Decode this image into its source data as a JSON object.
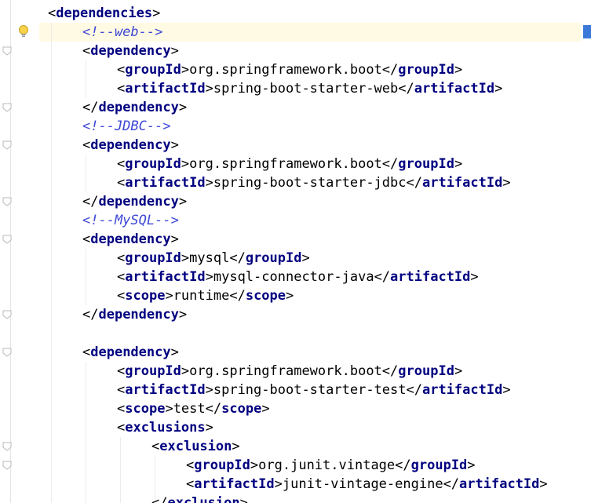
{
  "editor": {
    "language": "xml",
    "highlight_color": "#fffae3",
    "tag_color": "#000080",
    "comment_color": "#3d48d6",
    "gutter_icons": [
      "intention-bulb-icon",
      "fold-icon"
    ]
  },
  "code": {
    "lines": [
      {
        "indent": 1,
        "parts": [
          {
            "k": "p",
            "v": "<"
          },
          {
            "k": "t",
            "v": "dependencies"
          },
          {
            "k": "p",
            "v": ">"
          }
        ]
      },
      {
        "indent": 2,
        "parts": [
          {
            "k": "c",
            "v": "<!--web-->"
          }
        ]
      },
      {
        "indent": 2,
        "parts": [
          {
            "k": "p",
            "v": "<"
          },
          {
            "k": "t",
            "v": "dependency"
          },
          {
            "k": "p",
            "v": ">"
          }
        ]
      },
      {
        "indent": 3,
        "parts": [
          {
            "k": "p",
            "v": "<"
          },
          {
            "k": "t",
            "v": "groupId"
          },
          {
            "k": "p",
            "v": ">"
          },
          {
            "k": "tx",
            "v": "org.springframework.boot"
          },
          {
            "k": "p",
            "v": "</"
          },
          {
            "k": "t",
            "v": "groupId"
          },
          {
            "k": "p",
            "v": ">"
          }
        ]
      },
      {
        "indent": 3,
        "parts": [
          {
            "k": "p",
            "v": "<"
          },
          {
            "k": "t",
            "v": "artifactId"
          },
          {
            "k": "p",
            "v": ">"
          },
          {
            "k": "tx",
            "v": "spring-boot-starter-web"
          },
          {
            "k": "p",
            "v": "</"
          },
          {
            "k": "t",
            "v": "artifactId"
          },
          {
            "k": "p",
            "v": ">"
          }
        ]
      },
      {
        "indent": 2,
        "parts": [
          {
            "k": "p",
            "v": "</"
          },
          {
            "k": "t",
            "v": "dependency"
          },
          {
            "k": "p",
            "v": ">"
          }
        ]
      },
      {
        "indent": 2,
        "parts": [
          {
            "k": "c",
            "v": "<!--JDBC-->"
          }
        ]
      },
      {
        "indent": 2,
        "parts": [
          {
            "k": "p",
            "v": "<"
          },
          {
            "k": "t",
            "v": "dependency"
          },
          {
            "k": "p",
            "v": ">"
          }
        ]
      },
      {
        "indent": 3,
        "parts": [
          {
            "k": "p",
            "v": "<"
          },
          {
            "k": "t",
            "v": "groupId"
          },
          {
            "k": "p",
            "v": ">"
          },
          {
            "k": "tx",
            "v": "org.springframework.boot"
          },
          {
            "k": "p",
            "v": "</"
          },
          {
            "k": "t",
            "v": "groupId"
          },
          {
            "k": "p",
            "v": ">"
          }
        ]
      },
      {
        "indent": 3,
        "parts": [
          {
            "k": "p",
            "v": "<"
          },
          {
            "k": "t",
            "v": "artifactId"
          },
          {
            "k": "p",
            "v": ">"
          },
          {
            "k": "tx",
            "v": "spring-boot-starter-jdbc"
          },
          {
            "k": "p",
            "v": "</"
          },
          {
            "k": "t",
            "v": "artifactId"
          },
          {
            "k": "p",
            "v": ">"
          }
        ]
      },
      {
        "indent": 2,
        "parts": [
          {
            "k": "p",
            "v": "</"
          },
          {
            "k": "t",
            "v": "dependency"
          },
          {
            "k": "p",
            "v": ">"
          }
        ]
      },
      {
        "indent": 2,
        "parts": [
          {
            "k": "c",
            "v": "<!--MySQL-->"
          }
        ]
      },
      {
        "indent": 2,
        "parts": [
          {
            "k": "p",
            "v": "<"
          },
          {
            "k": "t",
            "v": "dependency"
          },
          {
            "k": "p",
            "v": ">"
          }
        ]
      },
      {
        "indent": 3,
        "parts": [
          {
            "k": "p",
            "v": "<"
          },
          {
            "k": "t",
            "v": "groupId"
          },
          {
            "k": "p",
            "v": ">"
          },
          {
            "k": "tx",
            "v": "mysql"
          },
          {
            "k": "p",
            "v": "</"
          },
          {
            "k": "t",
            "v": "groupId"
          },
          {
            "k": "p",
            "v": ">"
          }
        ]
      },
      {
        "indent": 3,
        "parts": [
          {
            "k": "p",
            "v": "<"
          },
          {
            "k": "t",
            "v": "artifactId"
          },
          {
            "k": "p",
            "v": ">"
          },
          {
            "k": "tx",
            "v": "mysql-connector-java"
          },
          {
            "k": "p",
            "v": "</"
          },
          {
            "k": "t",
            "v": "artifactId"
          },
          {
            "k": "p",
            "v": ">"
          }
        ]
      },
      {
        "indent": 3,
        "parts": [
          {
            "k": "p",
            "v": "<"
          },
          {
            "k": "t",
            "v": "scope"
          },
          {
            "k": "p",
            "v": ">"
          },
          {
            "k": "tx",
            "v": "runtime"
          },
          {
            "k": "p",
            "v": "</"
          },
          {
            "k": "t",
            "v": "scope"
          },
          {
            "k": "p",
            "v": ">"
          }
        ]
      },
      {
        "indent": 2,
        "parts": [
          {
            "k": "p",
            "v": "</"
          },
          {
            "k": "t",
            "v": "dependency"
          },
          {
            "k": "p",
            "v": ">"
          }
        ]
      },
      {
        "indent": 0,
        "parts": []
      },
      {
        "indent": 2,
        "parts": [
          {
            "k": "p",
            "v": "<"
          },
          {
            "k": "t",
            "v": "dependency"
          },
          {
            "k": "p",
            "v": ">"
          }
        ]
      },
      {
        "indent": 3,
        "parts": [
          {
            "k": "p",
            "v": "<"
          },
          {
            "k": "t",
            "v": "groupId"
          },
          {
            "k": "p",
            "v": ">"
          },
          {
            "k": "tx",
            "v": "org.springframework.boot"
          },
          {
            "k": "p",
            "v": "</"
          },
          {
            "k": "t",
            "v": "groupId"
          },
          {
            "k": "p",
            "v": ">"
          }
        ]
      },
      {
        "indent": 3,
        "parts": [
          {
            "k": "p",
            "v": "<"
          },
          {
            "k": "t",
            "v": "artifactId"
          },
          {
            "k": "p",
            "v": ">"
          },
          {
            "k": "tx",
            "v": "spring-boot-starter-test"
          },
          {
            "k": "p",
            "v": "</"
          },
          {
            "k": "t",
            "v": "artifactId"
          },
          {
            "k": "p",
            "v": ">"
          }
        ]
      },
      {
        "indent": 3,
        "parts": [
          {
            "k": "p",
            "v": "<"
          },
          {
            "k": "t",
            "v": "scope"
          },
          {
            "k": "p",
            "v": ">"
          },
          {
            "k": "tx",
            "v": "test"
          },
          {
            "k": "p",
            "v": "</"
          },
          {
            "k": "t",
            "v": "scope"
          },
          {
            "k": "p",
            "v": ">"
          }
        ]
      },
      {
        "indent": 3,
        "parts": [
          {
            "k": "p",
            "v": "<"
          },
          {
            "k": "t",
            "v": "exclusions"
          },
          {
            "k": "p",
            "v": ">"
          }
        ]
      },
      {
        "indent": 4,
        "parts": [
          {
            "k": "p",
            "v": "<"
          },
          {
            "k": "t",
            "v": "exclusion"
          },
          {
            "k": "p",
            "v": ">"
          }
        ]
      },
      {
        "indent": 5,
        "parts": [
          {
            "k": "p",
            "v": "<"
          },
          {
            "k": "t",
            "v": "groupId"
          },
          {
            "k": "p",
            "v": ">"
          },
          {
            "k": "tx",
            "v": "org.junit.vintage"
          },
          {
            "k": "p",
            "v": "</"
          },
          {
            "k": "t",
            "v": "groupId"
          },
          {
            "k": "p",
            "v": ">"
          }
        ]
      },
      {
        "indent": 5,
        "parts": [
          {
            "k": "p",
            "v": "<"
          },
          {
            "k": "t",
            "v": "artifactId"
          },
          {
            "k": "p",
            "v": ">"
          },
          {
            "k": "tx",
            "v": "junit-vintage-engine"
          },
          {
            "k": "p",
            "v": "</"
          },
          {
            "k": "t",
            "v": "artifactId"
          },
          {
            "k": "p",
            "v": ">"
          }
        ]
      },
      {
        "indent": 4,
        "parts": [
          {
            "k": "p",
            "v": "</"
          },
          {
            "k": "t",
            "v": "exclusion"
          },
          {
            "k": "p",
            "v": ">"
          }
        ]
      }
    ]
  }
}
